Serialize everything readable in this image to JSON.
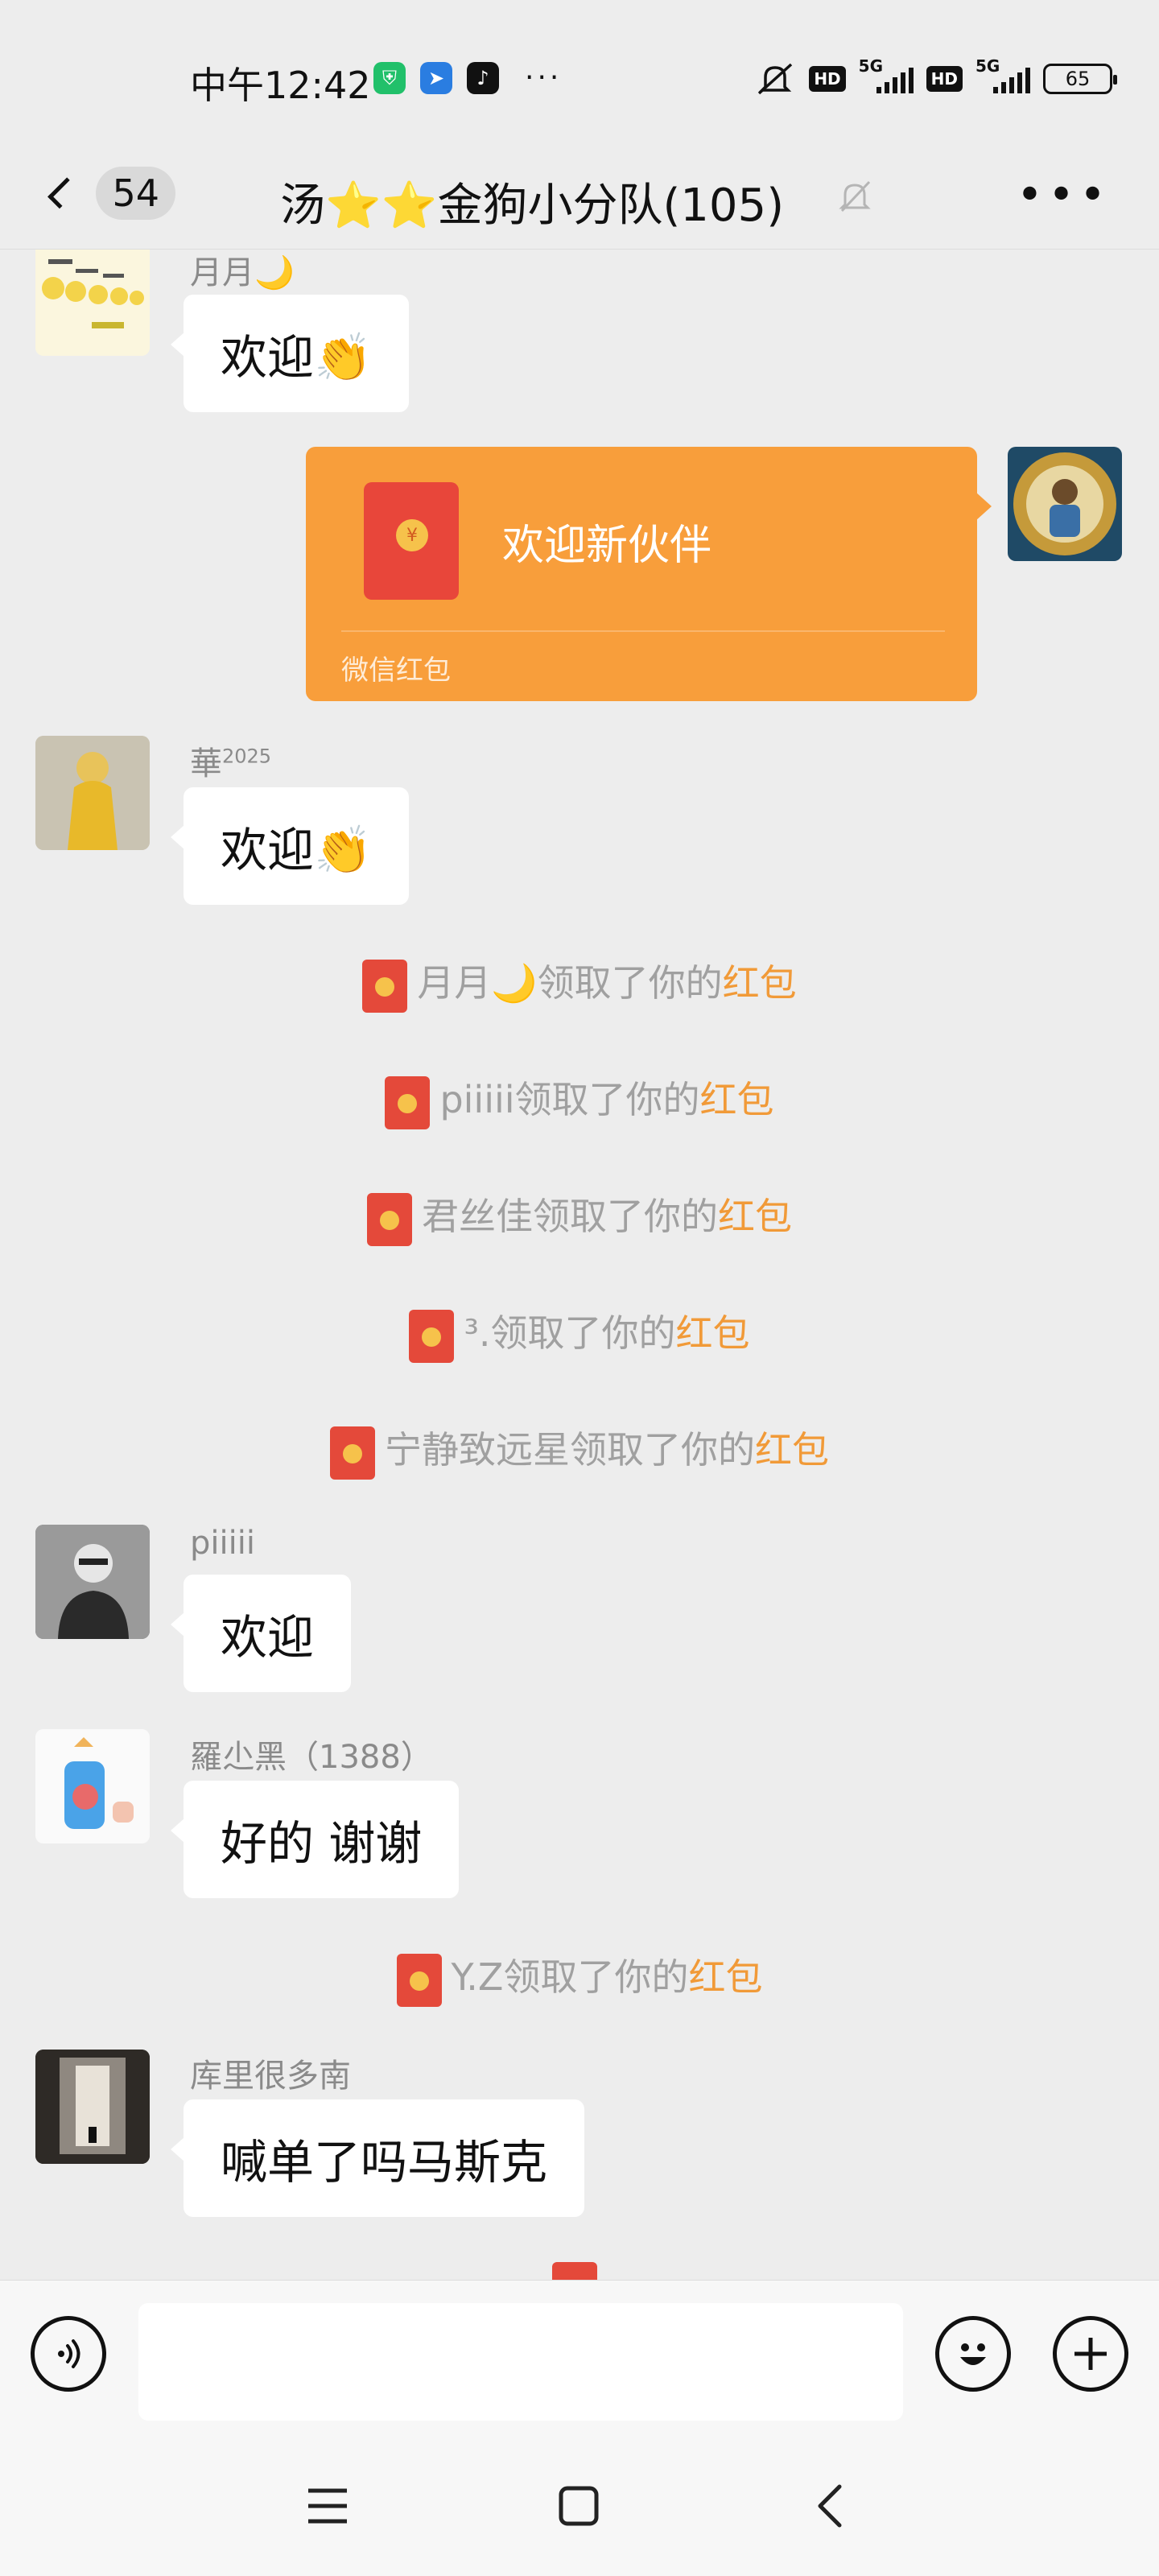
{
  "status": {
    "time": "中午12:42",
    "more": "···",
    "hd1": "HD",
    "net1": "5G",
    "hd2": "HD",
    "net2": "5G",
    "battery": "65"
  },
  "header": {
    "unread": "54",
    "title": "汤⭐⭐金狗小分队(105)"
  },
  "messages": {
    "m1": {
      "sender": "月月🌙",
      "text": "欢迎👏"
    },
    "redpacket": {
      "text": "欢迎新伙伴",
      "label": "微信红包",
      "coin": "¥"
    },
    "m2": {
      "sender": "華",
      "sender_sup": "2025",
      "text": "欢迎👏"
    },
    "sys1": {
      "prefix": "月月🌙领取了你的",
      "link": "红包"
    },
    "sys2": {
      "prefix": "piiiii领取了你的",
      "link": "红包"
    },
    "sys3": {
      "prefix": "君丝佳领取了你的",
      "link": "红包"
    },
    "sys4": {
      "prefix": "³.领取了你的",
      "link": "红包"
    },
    "sys5": {
      "prefix": "宁静致远星领取了你的",
      "link": "红包"
    },
    "m3": {
      "sender": "piiiii",
      "text": "欢迎"
    },
    "m4": {
      "sender": "羅尐黑（1388）",
      "text": "好的  谢谢"
    },
    "sys6": {
      "prefix": "Y.Z领取了你的",
      "link": "红包"
    },
    "m5": {
      "sender": "库里很多南",
      "text": "喊单了吗马斯克"
    }
  },
  "input": {
    "value": "",
    "placeholder": ""
  },
  "colors": {
    "background": "#ededed",
    "redpacket": "#f89e3b",
    "envelope": "#e4493a",
    "highlight": "#f19a38"
  },
  "icons": [
    "voice-icon",
    "emoji-icon",
    "plus-icon",
    "menu-icon",
    "home-icon",
    "back-icon",
    "mute-bell-icon"
  ]
}
